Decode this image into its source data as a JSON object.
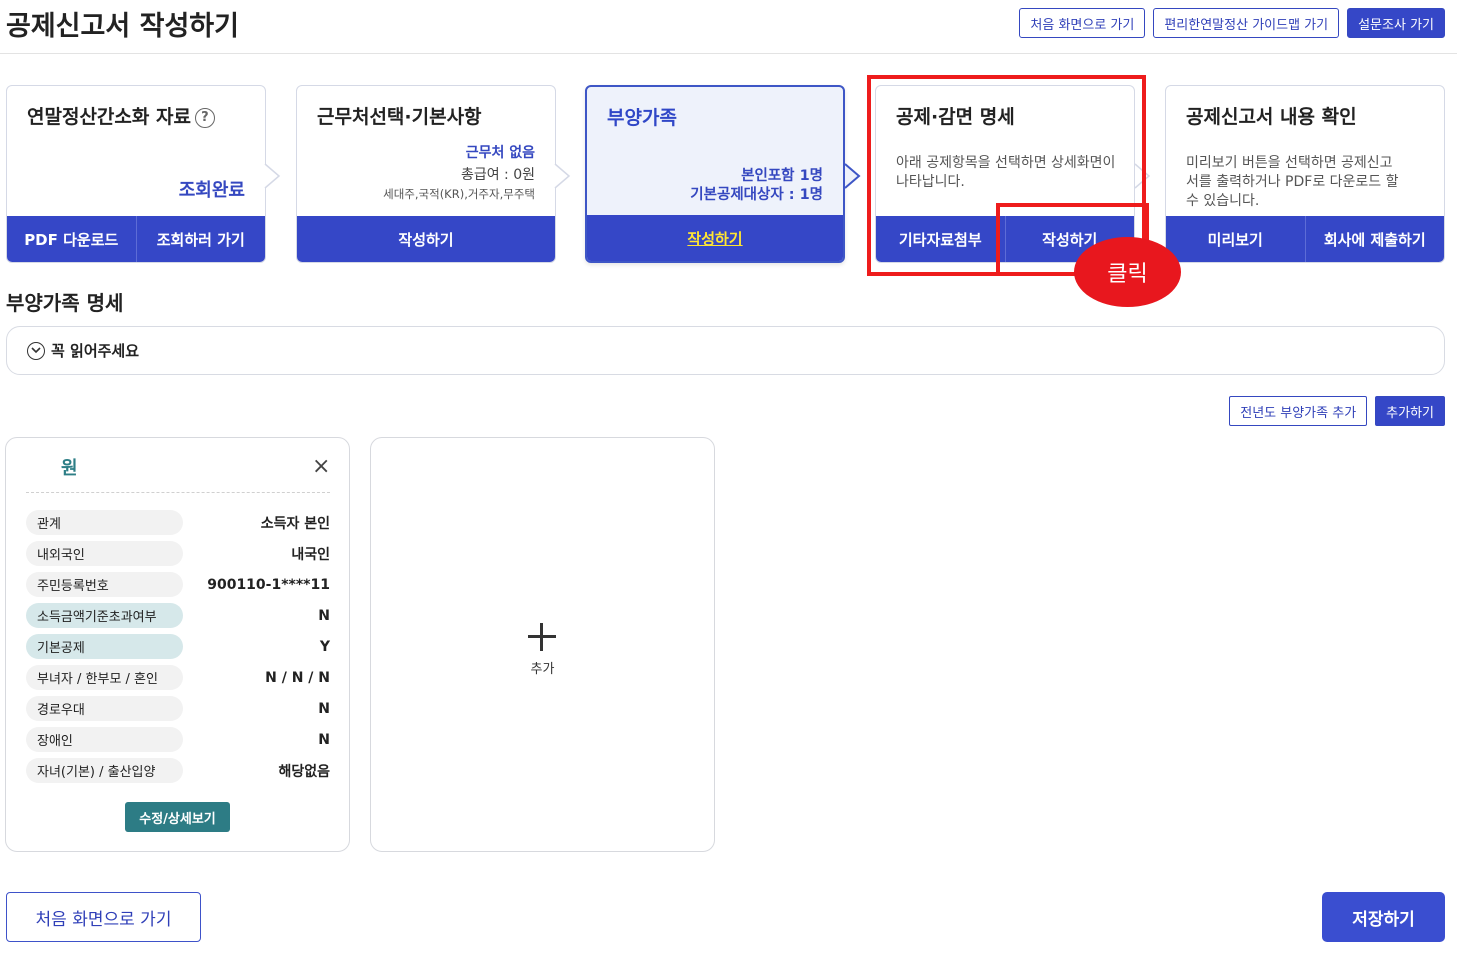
{
  "header": {
    "title": "공제신고서 작성하기",
    "buttons": [
      "처음 화면으로 가기",
      "편리한연말정산 가이드맵 가기",
      "설문조사 가기"
    ]
  },
  "steps": [
    {
      "title": "연말정산간소화 자료",
      "help": "?",
      "status": "조회완료",
      "buttons": [
        "PDF 다운로드",
        "조회하러 가기"
      ]
    },
    {
      "title": "근무처선택·기본사항",
      "status": "근무처 없음",
      "salary": "총급여 : 0원",
      "detail": "세대주,국적(KR),거주자,무주택",
      "buttons": [
        "작성하기"
      ]
    },
    {
      "title": "부양가족",
      "line1": "본인포함 1명",
      "line2": "기본공제대상자 : 1명",
      "buttons": [
        "작성하기"
      ]
    },
    {
      "title": "공제·감면 명세",
      "desc": "아래 공제항목을 선택하면 상세화면이 나타납니다.",
      "buttons": [
        "기타자료첨부",
        "작성하기"
      ]
    },
    {
      "title": "공제신고서 내용 확인",
      "desc": "미리보기 버튼을 선택하면 공제신고서를 출력하거나 PDF로 다운로드 할 수 있습니다.",
      "buttons": [
        "미리보기",
        "회사에 제출하기"
      ]
    }
  ],
  "annotation": {
    "click_label": "클릭"
  },
  "section": {
    "title": "부양가족 명세",
    "notice": "꼭 읽어주세요",
    "add_buttons": [
      "전년도 부양가족 추가",
      "추가하기"
    ]
  },
  "card": {
    "name": "원",
    "close": "×",
    "rows": [
      {
        "label": "관계",
        "value": "소득자 본인"
      },
      {
        "label": "내외국인",
        "value": "내국인"
      },
      {
        "label": "주민등록번호",
        "value": "900110-1****11"
      },
      {
        "label": "소득금액기준초과여부",
        "value": "N"
      },
      {
        "label": "기본공제",
        "value": "Y"
      },
      {
        "label": "부녀자 / 한부모 / 혼인",
        "value": "N / N / N"
      },
      {
        "label": "경로우대",
        "value": "N"
      },
      {
        "label": "장애인",
        "value": "N"
      },
      {
        "label": "자녀(기본) / 출산입양",
        "value": "해당없음"
      }
    ],
    "edit_button": "수정/상세보기"
  },
  "add_card": {
    "label": "추가"
  },
  "footer": {
    "home_button": "처음 화면으로 가기",
    "save_button": "저장하기"
  },
  "colors": {
    "primary": "#3547c7",
    "teal": "#2d7c85",
    "annotation_red": "#ee1c1c",
    "active_step_bg": "#eef2fb",
    "highlight_yellow": "#ffe632"
  }
}
